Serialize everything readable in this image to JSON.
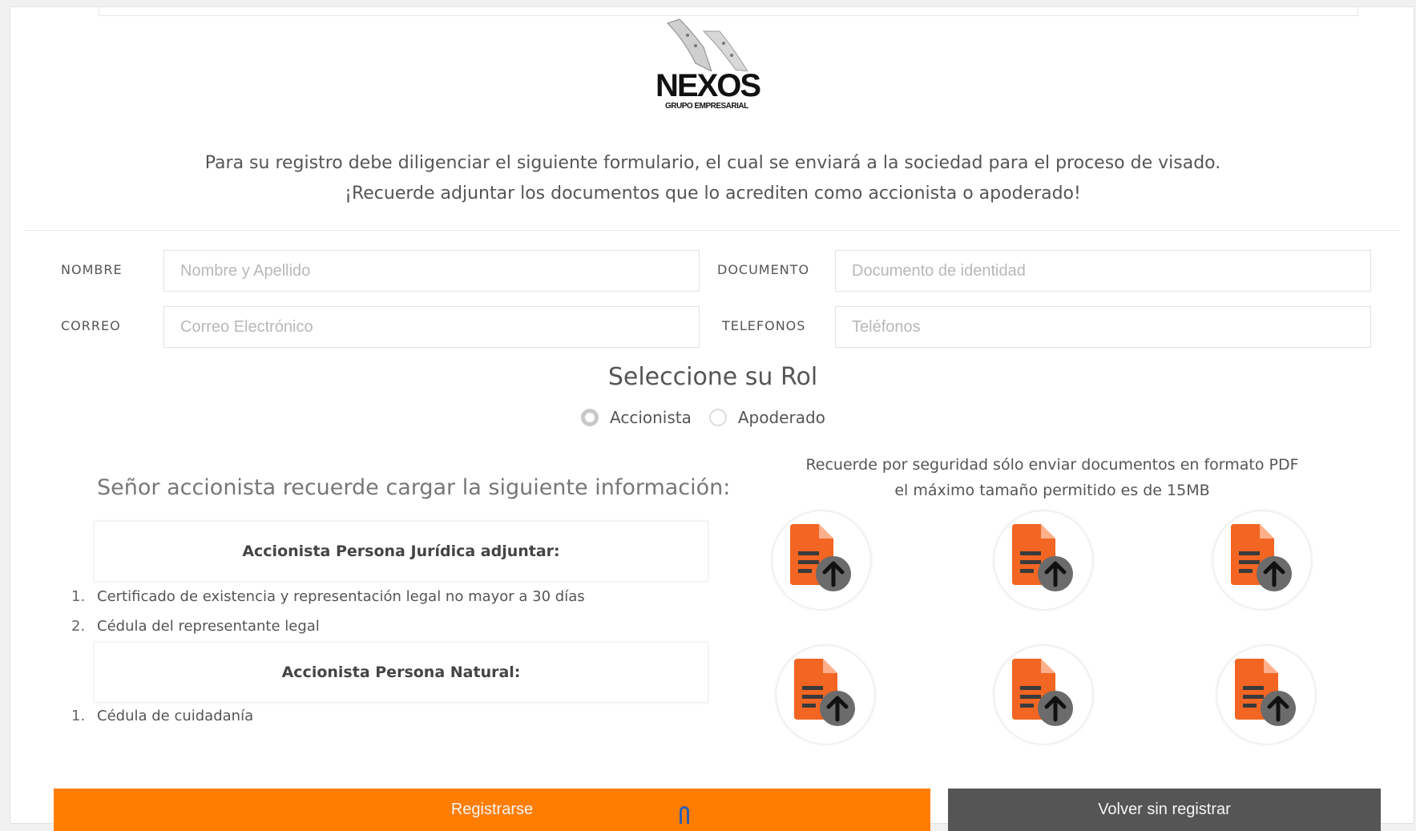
{
  "brand": {
    "logo_text": "NEXOS",
    "logo_subtitle": "GRUPO EMPRESARIAL"
  },
  "intro": {
    "line1": "Para su registro debe diligenciar el siguiente formulario, el cual se enviará a la sociedad para el proceso de visado.",
    "line2": "¡Recuerde adjuntar los documentos que lo acrediten como accionista o apoderado!"
  },
  "form": {
    "nombre": {
      "label": "NOMBRE",
      "placeholder": "Nombre y Apellido",
      "value": ""
    },
    "documento": {
      "label": "DOCUMENTO",
      "placeholder": "Documento de identidad",
      "value": ""
    },
    "correo": {
      "label": "CORREO",
      "placeholder": "Correo Electrónico",
      "value": ""
    },
    "telefonos": {
      "label": "TELEFONOS",
      "placeholder": "Teléfonos",
      "value": ""
    }
  },
  "role": {
    "title": "Seleccione su Rol",
    "options": [
      {
        "label": "Accionista",
        "selected": true
      },
      {
        "label": "Apoderado",
        "selected": false
      }
    ]
  },
  "info": {
    "reminder": "Señor accionista recuerde cargar la siguiente información:",
    "juridica": {
      "title": "Accionista Persona Jurídica adjuntar:",
      "items": [
        {
          "num": "1.",
          "text": "Certificado de existencia y representación legal no mayor a 30 días"
        },
        {
          "num": "2.",
          "text": "Cédula del representante legal"
        }
      ]
    },
    "natural": {
      "title": "Accionista Persona Natural:",
      "items": [
        {
          "num": "1.",
          "text": "Cédula de cuidadanía"
        }
      ]
    }
  },
  "uploads": {
    "note_line1": "Recuerde por seguridad sólo enviar documentos en formato PDF",
    "note_line2": "el máximo tamaño permitido es de 15MB",
    "icon": "pdf-upload-icon",
    "accent_color": "#f26522"
  },
  "actions": {
    "register": "Registrarse",
    "back": "Volver sin registrar"
  },
  "colors": {
    "primary": "#ff7d00",
    "secondary": "#555555"
  }
}
